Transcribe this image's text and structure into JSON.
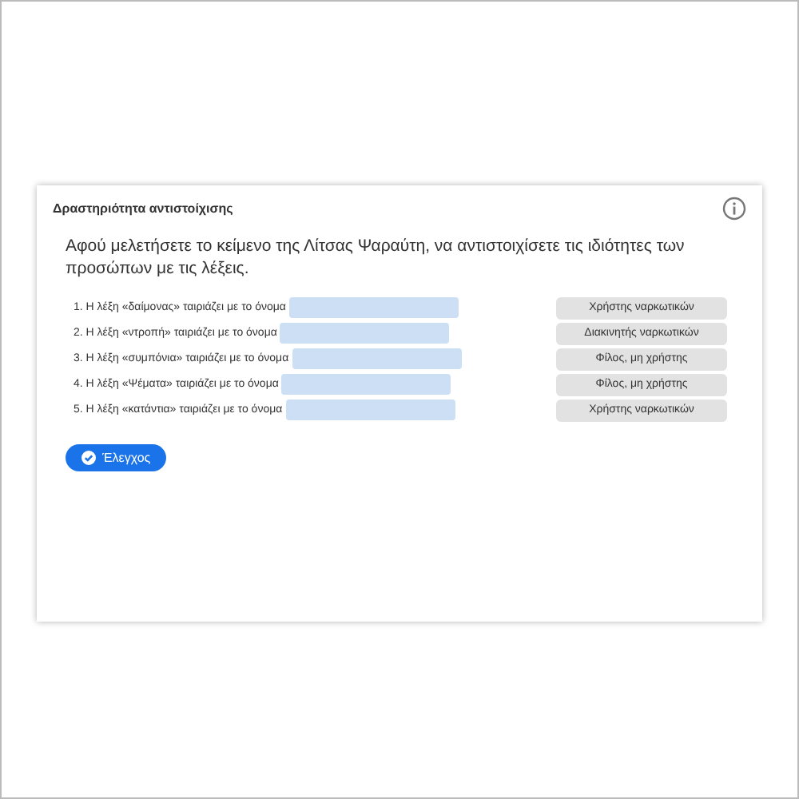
{
  "activity": {
    "title": "Δραστηριότητα αντιστοίχισης",
    "instruction": "Αφού μελετήσετε το κείμενο της Λίτσας Ψαραύτη, να αντιστοιχίσετε τις ιδιότητες των προσώπων με τις λέξεις.",
    "items": [
      {
        "text": "1. Η λέξη «δαίμονας» ταιριάζει με το όνομα"
      },
      {
        "text": "2. Η λέξη «ντροπή» ταιριάζει με το όνομα"
      },
      {
        "text": "3. Η λέξη «συμπόνια» ταιριάζει με το όνομα"
      },
      {
        "text": "4. Η λέξη «Ψέματα» ταιριάζει με το όνομα"
      },
      {
        "text": "5. Η λέξη «κατάντια» ταιριάζει με το όνομα"
      }
    ],
    "options": [
      "Χρήστης ναρκωτικών",
      "Διακινητής ναρκωτικών",
      "Φίλος, μη χρήστης",
      "Φίλος, μη χρήστης",
      "Χρήστης ναρκωτικών"
    ],
    "check_button": "Έλεγχος"
  }
}
